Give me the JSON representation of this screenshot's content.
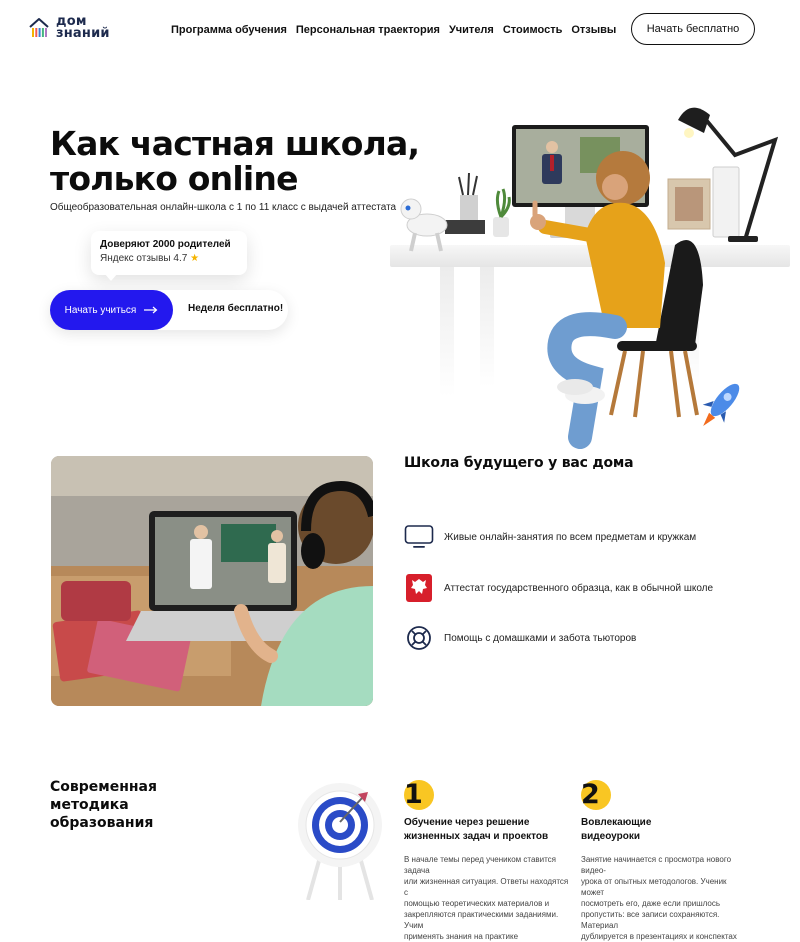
{
  "header": {
    "logo_line1": "дом",
    "logo_line2": "знаний",
    "nav": [
      "Программа обучения",
      "Персональная траектория",
      "Учителя",
      "Стоимость",
      "Отзывы"
    ],
    "cta": "Начать бесплатно"
  },
  "hero": {
    "title_line1": "Как частная школа,",
    "title_line2": "только online",
    "subtitle": "Общеобразовательная онлайн-школа с 1 по 11 класс с выдачей аттестата",
    "trust_title": "Доверяют 2000 родителей",
    "trust_rating": "Яндекс отзывы 4.7",
    "primary_button": "Начать учиться",
    "secondary_button": "Неделя бесплатно!"
  },
  "section2": {
    "title": "Школа будущего у вас дома",
    "features": [
      {
        "icon": "monitor-icon",
        "text": "Живые онлайн-занятия по всем предметам и кружкам"
      },
      {
        "icon": "coat-of-arms-icon",
        "text": "Аттестат государственного образца, как в обычной школе"
      },
      {
        "icon": "lifebuoy-icon",
        "text": "Помощь с домашками и забота тьюторов"
      }
    ]
  },
  "section3": {
    "title_line1": "Современная",
    "title_line2": "методика",
    "title_line3": "образования",
    "cards": [
      {
        "number": "1",
        "title_line1": "Обучение через решение",
        "title_line2": "жизненных задач и проектов",
        "text": [
          "В начале темы перед учеником ставится задача",
          "или жизненная ситуация. Ответы находятся с",
          "помощью теоретических материалов и",
          "закрепляются практическими заданиями. Учим",
          "применять знания на практике"
        ]
      },
      {
        "number": "2",
        "title_line1": "Вовлекающие",
        "title_line2": "видеоуроки",
        "text": [
          "Занятие начинается с просмотра нового видео-",
          "урока от опытных методологов. Ученик может",
          "посмотреть его, даже если пришлось",
          "пропустить: все записи сохраняются. Материал",
          "дублируется в презентациях и конспектах"
        ]
      }
    ]
  },
  "colors": {
    "accent_blue": "#2318ee",
    "badge_yellow": "#f9c623",
    "logo_stripes": [
      "#f5b400",
      "#f25c54",
      "#3b7dd8",
      "#43b581",
      "#9b59b6"
    ]
  }
}
